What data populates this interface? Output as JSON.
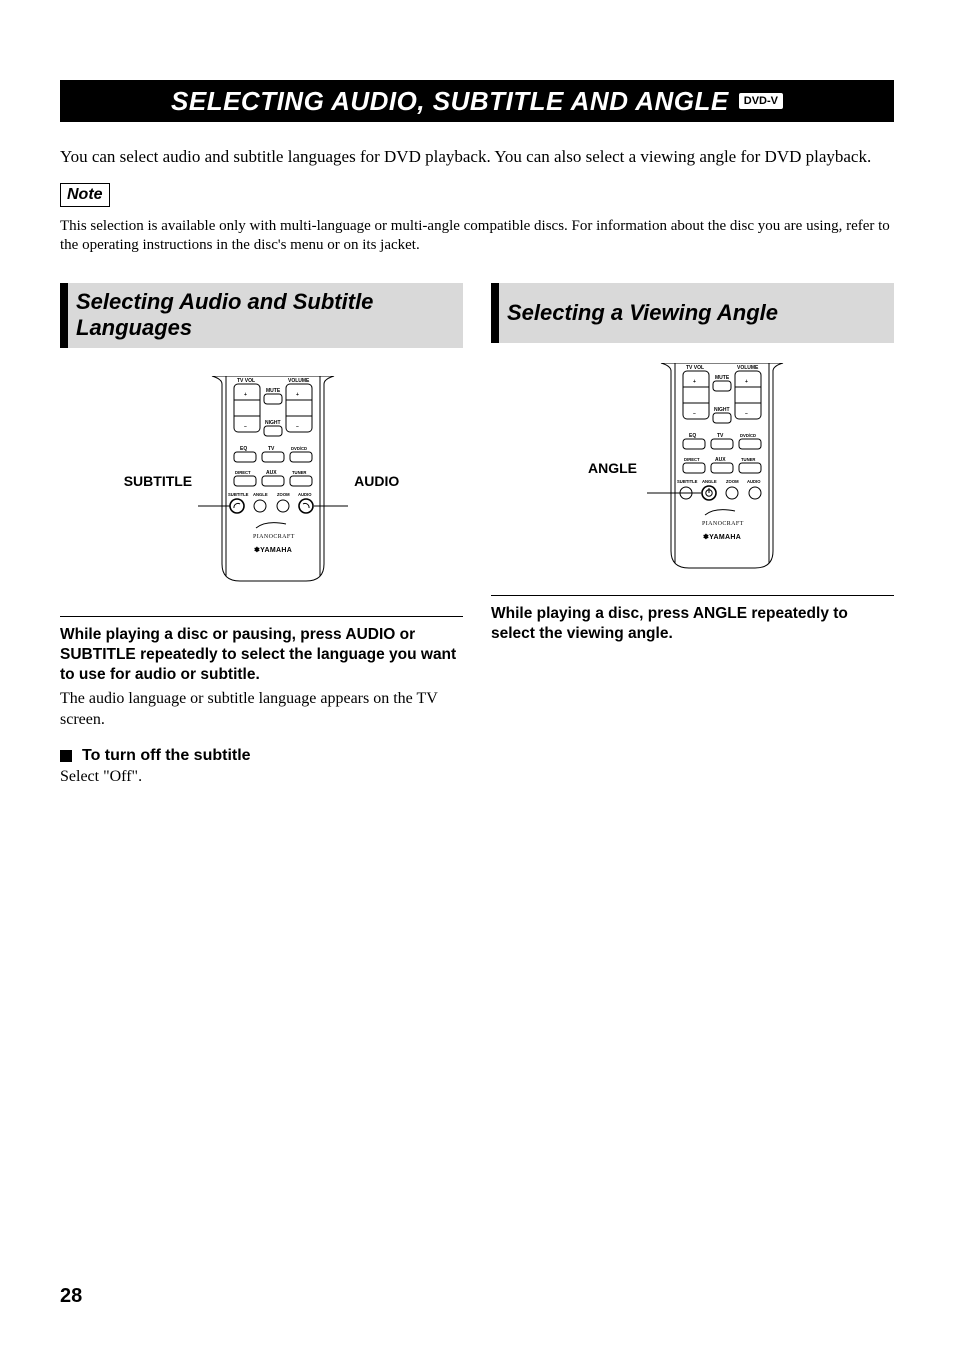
{
  "banner": {
    "title": "SELECTING AUDIO, SUBTITLE AND ANGLE",
    "badge": "DVD-V"
  },
  "intro": "You can select audio and subtitle languages for DVD playback. You can also select a viewing angle for DVD playback.",
  "note": {
    "label": "Note",
    "body": "This selection is available only with multi-language or multi-angle compatible discs. For information about the disc you are using, refer to the operating instructions in the disc's menu or on its jacket."
  },
  "left": {
    "heading": "Selecting Audio and Subtitle Languages",
    "callouts": {
      "subtitle": "SUBTITLE",
      "audio": "AUDIO"
    },
    "step": "While playing a disc or pausing, press AUDIO or SUBTITLE repeatedly to select the language you want to use for audio or subtitle.",
    "body": "The audio language or subtitle language appears on the TV screen.",
    "sub_h": "To turn off the subtitle",
    "sub_b": "Select \"Off\"."
  },
  "right": {
    "heading": "Selecting a Viewing Angle",
    "callouts": {
      "angle": "ANGLE"
    },
    "step": "While playing a disc, press ANGLE repeatedly to select the viewing angle."
  },
  "remote": {
    "tvvol": "TV VOL",
    "volume": "VOLUME",
    "mute": "MUTE",
    "night": "NIGHT",
    "eq": "EQ",
    "tv": "TV",
    "dvdcd": "DVD/CD",
    "direct": "DIRECT",
    "aux": "AUX",
    "tuner": "TUNER",
    "subtitle": "SUBTITLE",
    "angle": "ANGLE",
    "zoom": "ZOOM",
    "audio": "AUDIO",
    "plus": "+",
    "minus": "–",
    "brand_pc": "PIANOCRAFT",
    "brand_y": "YAMAHA"
  },
  "page_number": "28"
}
